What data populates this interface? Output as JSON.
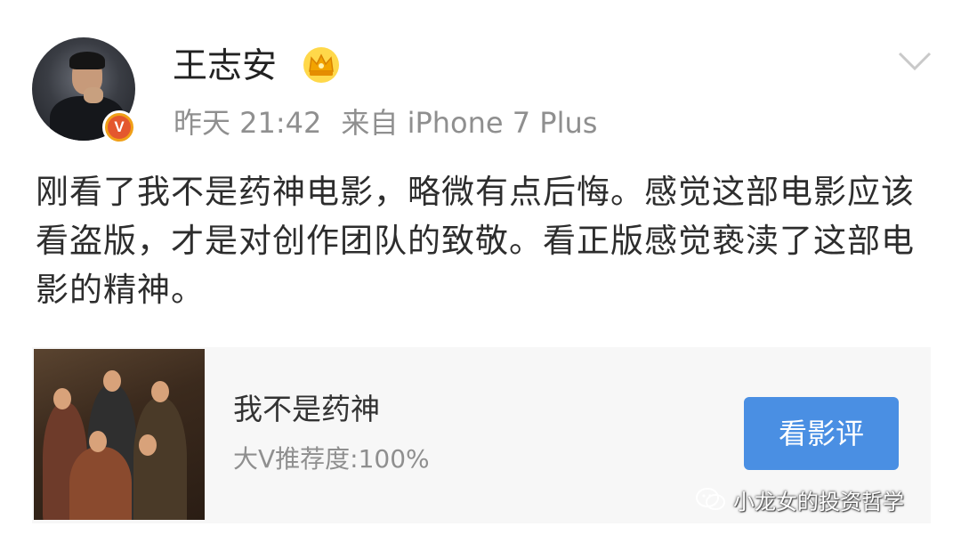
{
  "post": {
    "author": "王志安",
    "time": "昨天 21:42",
    "source": "来自 iPhone 7 Plus",
    "text": "刚看了我不是药神电影，略微有点后悔。感觉这部电影应该看盗版，才是对创作团队的致敬。看正版感觉亵渎了这部电影的精神。",
    "badge_icon": "crown-icon",
    "verified_icon": "verified-v-icon",
    "verified_letter": "V",
    "menu_icon": "chevron-down-icon"
  },
  "card": {
    "title": "我不是药神",
    "subtitle": "大V推荐度:100%",
    "button_label": "看影评",
    "button_color": "#4a8fe3"
  },
  "watermark": {
    "text": "小龙女的投资哲学",
    "icon": "wechat-icon"
  }
}
